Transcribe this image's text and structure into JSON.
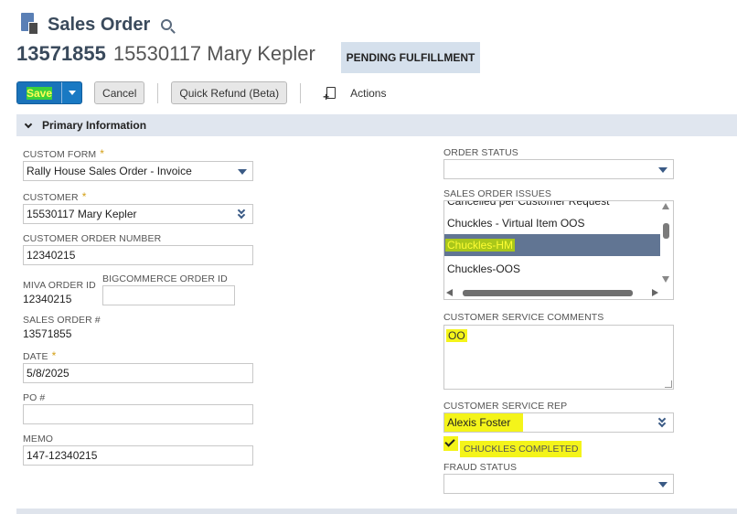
{
  "header": {
    "title": "Sales Order",
    "record_number": "13571855",
    "record_name": "15530117 Mary Kepler",
    "status": "PENDING FULFILLMENT"
  },
  "toolbar": {
    "save_label": "Save",
    "cancel_label": "Cancel",
    "quick_refund_label": "Quick Refund (Beta)",
    "actions_label": "Actions"
  },
  "section": {
    "title": "Primary Information"
  },
  "left": {
    "custom_form": {
      "label": "CUSTOM FORM",
      "required": "*",
      "value": "Rally House Sales Order - Invoice"
    },
    "customer": {
      "label": "CUSTOMER",
      "required": "*",
      "value": "15530117 Mary Kepler"
    },
    "customer_order_number": {
      "label": "CUSTOMER ORDER NUMBER",
      "value": "12340215"
    },
    "miva_order_id": {
      "label": "MIVA ORDER ID",
      "value": "12340215"
    },
    "bigcommerce_order_id": {
      "label": "BIGCOMMERCE ORDER ID",
      "value": ""
    },
    "sales_order_num": {
      "label": "SALES ORDER #",
      "value": "13571855"
    },
    "date": {
      "label": "DATE",
      "required": "*",
      "value": "5/8/2025"
    },
    "po_num": {
      "label": "PO #",
      "value": ""
    },
    "memo": {
      "label": "MEMO",
      "value": "147-12340215"
    }
  },
  "right": {
    "order_status": {
      "label": "ORDER STATUS",
      "value": ""
    },
    "sales_order_issues": {
      "label": "SALES ORDER ISSUES",
      "items": [
        "Cancelled per Customer Request",
        "Chuckles - Virtual Item OOS",
        "Chuckles-HM",
        "Chuckles-OOS"
      ],
      "selected_index": 2
    },
    "customer_service_comments": {
      "label": "CUSTOMER SERVICE COMMENTS",
      "value": "OO"
    },
    "customer_service_rep": {
      "label": "CUSTOMER SERVICE REP",
      "value": "Alexis Foster"
    },
    "chuckles_completed": {
      "label": "CHUCKLES COMPLETED",
      "checked": true
    },
    "fraud_status": {
      "label": "FRAUD STATUS",
      "value": ""
    }
  },
  "colors": {
    "save_blue": "#1979c3",
    "section_bar": "#e0e6ef",
    "selected_row": "#617593",
    "highlight_yellow": "#f4f41a",
    "required_star": "#d4a017"
  }
}
